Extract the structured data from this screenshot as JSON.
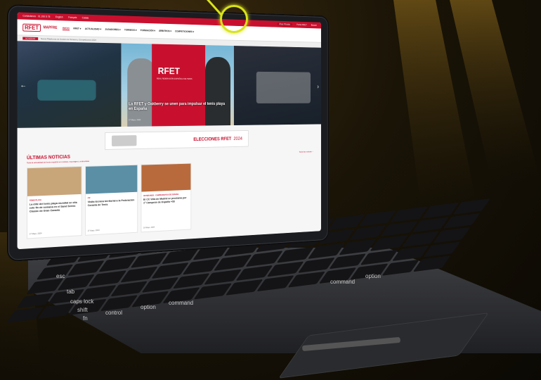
{
  "utility": {
    "left_text": "Contáctanos  · 91 200 5 78",
    "english": "English",
    "français": "Français",
    "catalan": "Català",
    "area_privada": "Área Privada",
    "portal_rfet": "Portal RFET",
    "search": "Buscar"
  },
  "logo": {
    "rfet": "RFET",
    "mapfre": "MAPFRE",
    "tagline": "Tenis España"
  },
  "nav": [
    "INICIO",
    "RFET ▾",
    "ACTUALIDAD ▾",
    "JUGADORES ▾",
    "TORNEOS ▾",
    "FORMACIÓN ▾",
    "ÁRBITROS ▾",
    "COMPETICIONES ▾"
  ],
  "breadcrumb": {
    "tag": "NOVEDAD",
    "text": "Nueva Plataforma de Gestión de Torneos y Competiciones 2024"
  },
  "hero": {
    "brand": "RFET",
    "brand_sub": "REAL FEDERACIÓN ESPAÑOLA DE TENIS",
    "caption": "La RFET y Oakberry se unen para impulsar el tenis playa en España",
    "date": "17 Mayo, 2024"
  },
  "elections": {
    "label": "ELECCIONES RFET",
    "year": "2024"
  },
  "news": {
    "title": "ÚLTIMAS NOTICIAS",
    "subtitle": "Toda la actualidad del tenis español en noticias, reportajes y entrevistas",
    "more": "Todas las noticias →",
    "cards": [
      {
        "category": "TENIS PLAYA",
        "headline": "La élite del tenis playa mundial se cita este fin de semana en el Sand Series Classic de Gran Canaria",
        "date": "17 Mayo, 2024",
        "img_color": "#c9a57a"
      },
      {
        "category": "ITF",
        "headline": "Visita técnica territorial a la Federación Canaria de Tenis",
        "date": "17 Mayo, 2024",
        "img_color": "#5a8fa6"
      },
      {
        "category": "VETERANOS · CAMPEONATOS DE ESPAÑA",
        "headline": "El CC Villa de Madrid se proclama por 1ª Campeón de España +55",
        "date": "16 Mayo, 2024",
        "img_color": "#b86a3c"
      }
    ]
  },
  "keyboard": {
    "labels": [
      "esc",
      "tab",
      "caps lock",
      "shift",
      "fn",
      "control",
      "option",
      "command",
      "command",
      "option"
    ]
  }
}
